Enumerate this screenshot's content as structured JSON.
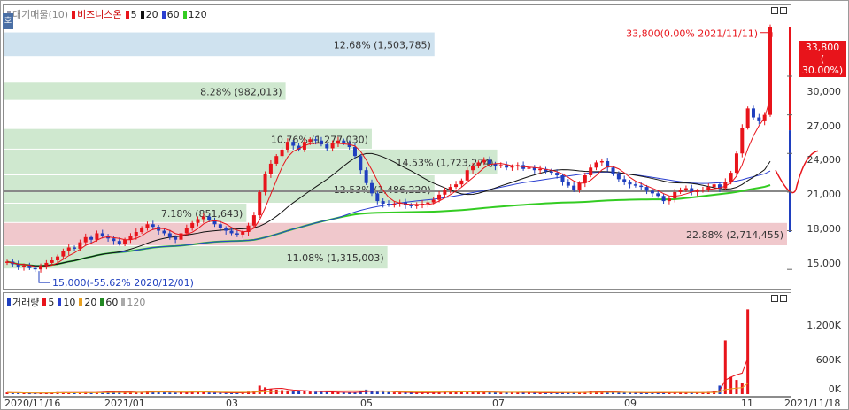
{
  "price_legend": {
    "label1": "대기매물(10)",
    "label2": "비즈니스온",
    "ma5": "5",
    "ma20": "20",
    "ma60": "60",
    "ma120": "120"
  },
  "volume_legend": {
    "label": "거래량",
    "ma5": "5",
    "ma10": "10",
    "ma20": "20",
    "ma60": "60",
    "ma120": "120"
  },
  "side_button": "호",
  "colors": {
    "up": "#e8141b",
    "down": "#1f3fbf",
    "ma5": "#e8141b",
    "ma20": "#111111",
    "ma60": "#2a3fd0",
    "ma120": "#33cc22",
    "band_green": "#cfe8cf",
    "band_blue": "#cfe2ef",
    "band_pink": "#f0c8cc"
  },
  "price_axis": {
    "ticks": [
      "33,000",
      "30,000",
      "27,000",
      "24,000",
      "21,000",
      "18,000",
      "15,000"
    ],
    "min": 13500,
    "max": 35500
  },
  "volume_axis": {
    "ticks": [
      "1,200K",
      "600K",
      "0K"
    ]
  },
  "current_price_tag": {
    "price": "33,800",
    "change": "( 30.00%)"
  },
  "annotations": {
    "high": "33,800(0.00% 2021/11/11)",
    "low": "15,000(-55.62% 2020/12/01)"
  },
  "x_labels": [
    "2020/11/16",
    "2021/01",
    "03",
    "05",
    "07",
    "09",
    "11",
    "2021/11/18"
  ],
  "chart_data": {
    "type": "candlestick",
    "volume_profile_bands": [
      {
        "label": "12.68% (1,503,785)",
        "low": 31500,
        "high": 33400,
        "color": "blue",
        "length": 0.55
      },
      {
        "label": "8.28% (982,013)",
        "low": 28100,
        "high": 29500,
        "color": "green",
        "length": 0.36
      },
      {
        "label": "10.76% (1,277,030)",
        "low": 24300,
        "high": 25900,
        "color": "green",
        "length": 0.47
      },
      {
        "label": "14.53% (1,723,274)",
        "low": 22300,
        "high": 24300,
        "color": "green",
        "length": 0.63
      },
      {
        "label": "12.53% (1,486,220)",
        "low": 20100,
        "high": 22300,
        "color": "green",
        "length": 0.55
      },
      {
        "label": "7.18% (851,643)",
        "low": 18600,
        "high": 20100,
        "color": "green",
        "length": 0.31
      },
      {
        "label": "22.88% (2,714,455)",
        "low": 16800,
        "high": 18600,
        "color": "pink",
        "length": 1.0
      },
      {
        "label": "11.08% (1,315,003)",
        "low": 15000,
        "high": 16800,
        "color": "green",
        "length": 0.49
      }
    ],
    "close_series": [
      15600,
      15400,
      15200,
      15300,
      15100,
      15000,
      15300,
      15500,
      15700,
      16000,
      16400,
      16700,
      16600,
      17100,
      17500,
      17300,
      17800,
      17600,
      17400,
      17200,
      17000,
      17300,
      17600,
      17900,
      18200,
      18500,
      18300,
      18000,
      17800,
      17500,
      17300,
      17800,
      18200,
      18600,
      18900,
      19100,
      18800,
      18500,
      18200,
      18000,
      17800,
      17700,
      17900,
      18400,
      19200,
      21000,
      22400,
      23200,
      23800,
      24300,
      24900,
      24600,
      24300,
      24900,
      25100,
      25000,
      24700,
      24400,
      24800,
      25000,
      24800,
      24500,
      23800,
      22700,
      21700,
      20900,
      20300,
      20100,
      20000,
      20100,
      20200,
      20000,
      19900,
      20000,
      20100,
      20200,
      20400,
      20800,
      21200,
      21400,
      21600,
      21900,
      22700,
      23000,
      23300,
      23500,
      23200,
      23000,
      23100,
      22900,
      23000,
      23100,
      22800,
      22900,
      22700,
      22800,
      22600,
      22500,
      22300,
      21800,
      21500,
      21200,
      21700,
      22300,
      22900,
      23300,
      23400,
      22900,
      22400,
      22000,
      21800,
      21600,
      21500,
      21400,
      21100,
      20900,
      20700,
      20300,
      20500,
      21000,
      21200,
      21300,
      21000,
      21100,
      21200,
      21400,
      21600,
      21300,
      21800,
      22500,
      24000,
      26000,
      27500,
      26800,
      26500,
      27000,
      33800
    ],
    "ma5": "computed",
    "ma20": "computed",
    "ma60": "computed",
    "ma120": "computed",
    "volume_series": [
      30,
      20,
      25,
      20,
      15,
      18,
      22,
      20,
      28,
      35,
      30,
      25,
      22,
      30,
      35,
      30,
      28,
      40,
      60,
      45,
      38,
      30,
      28,
      35,
      40,
      55,
      50,
      45,
      30,
      28,
      26,
      35,
      40,
      45,
      38,
      32,
      28,
      25,
      22,
      20,
      22,
      25,
      30,
      45,
      60,
      150,
      120,
      90,
      80,
      70,
      65,
      60,
      55,
      50,
      45,
      40,
      38,
      36,
      34,
      32,
      30,
      28,
      30,
      60,
      80,
      55,
      45,
      40,
      35,
      30,
      28,
      26,
      25,
      24,
      26,
      30,
      35,
      40,
      45,
      38,
      35,
      40,
      45,
      42,
      38,
      36,
      34,
      32,
      30,
      28,
      30,
      32,
      28,
      26,
      24,
      22,
      22,
      24,
      26,
      30,
      28,
      26,
      30,
      40,
      55,
      45,
      40,
      35,
      32,
      30,
      28,
      26,
      24,
      22,
      20,
      22,
      25,
      30,
      28,
      26,
      25,
      24,
      26,
      28,
      32,
      40,
      60,
      150,
      950,
      300,
      250,
      200,
      1500
    ]
  }
}
